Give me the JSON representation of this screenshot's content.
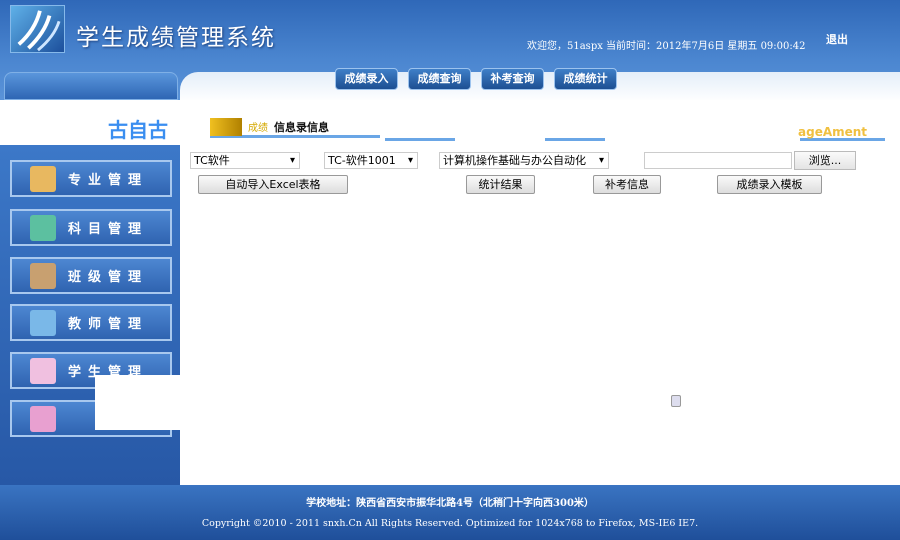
{
  "header": {
    "title": "学生成绩管理系统",
    "welcome": "欢迎您，51aspx  当前时间：2012年7月6日 星期五 09:00:42",
    "logout": "退出"
  },
  "nav": [
    "成绩录入",
    "成绩查询",
    "补考查询",
    "成绩统计"
  ],
  "section": {
    "label1": "成绩",
    "label2": "信息录信息",
    "right_text": "ageAment",
    "glitch": "古自古"
  },
  "sidebar": [
    "专业管理",
    "科目管理",
    "班级管理",
    "教师管理",
    "学生管理"
  ],
  "form": {
    "major": "TC软件",
    "class": "TC-软件1001",
    "course": "计算机操作基础与办公自动化",
    "browse": "浏览...",
    "import_btn": "自动导入Excel表格",
    "stats_btn": "统计结果",
    "makeup_btn": "补考信息",
    "template_btn": "成绩录入模板"
  },
  "footer": {
    "address": "学校地址：陕西省西安市振华北路4号（北稍门十字向西300米）",
    "copyright": "Copyright ©2010 - 2011 snxh.Cn All Rights Reserved. Optimized for 1024x768 to Firefox, MS-IE6 IE7."
  }
}
